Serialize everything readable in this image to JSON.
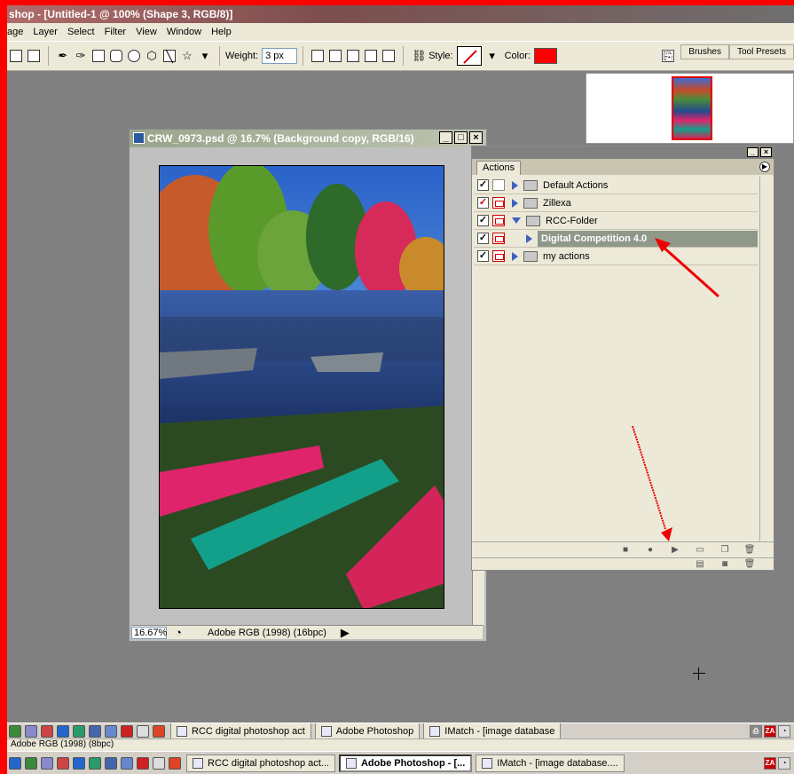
{
  "app": {
    "title": "shop - [Untitled-1 @ 100% (Shape 3, RGB/8)]"
  },
  "menu": [
    "age",
    "Layer",
    "Select",
    "Filter",
    "View",
    "Window",
    "Help"
  ],
  "options_bar": {
    "weight_label": "Weight:",
    "weight_value": "3 px",
    "style_label": "Style:",
    "color_label": "Color:",
    "color_value": "#ff0000"
  },
  "palette_tabs": [
    "Brushes",
    "Tool Presets"
  ],
  "document": {
    "title": "CRW_0973.psd @ 16.7% (Background copy, RGB/16)",
    "zoom": "16.67%",
    "profile": "Adobe RGB (1998) (16bpc)"
  },
  "actions_panel": {
    "tab": "Actions",
    "rows": [
      {
        "label": "Default Actions",
        "checked": true,
        "dialog": false,
        "expanded": false,
        "indent": 0
      },
      {
        "label": "Zillexa",
        "checked": true,
        "dialog": true,
        "expanded": false,
        "indent": 0
      },
      {
        "label": "RCC-Folder",
        "checked": true,
        "dialog": true,
        "expanded": true,
        "indent": 0
      },
      {
        "label": "Digital Competition 4.0",
        "checked": true,
        "dialog": true,
        "expanded": false,
        "indent": 1,
        "selected": true
      },
      {
        "label": "my actions",
        "checked": true,
        "dialog": true,
        "expanded": false,
        "indent": 0
      }
    ]
  },
  "annotations": {
    "arrow_color": "#ee0000"
  },
  "taskbar_top": {
    "items": [
      "RCC digital photoshop act",
      "Adobe Photoshop",
      "IMatch - [image database"
    ]
  },
  "status_bottom": {
    "profile": "Adobe RGB (1998) (8bpc)"
  },
  "taskbar_bottom": {
    "items": [
      "RCC digital photoshop act...",
      "Adobe Photoshop - [...",
      "IMatch - [image database...."
    ],
    "active_index": 1
  }
}
